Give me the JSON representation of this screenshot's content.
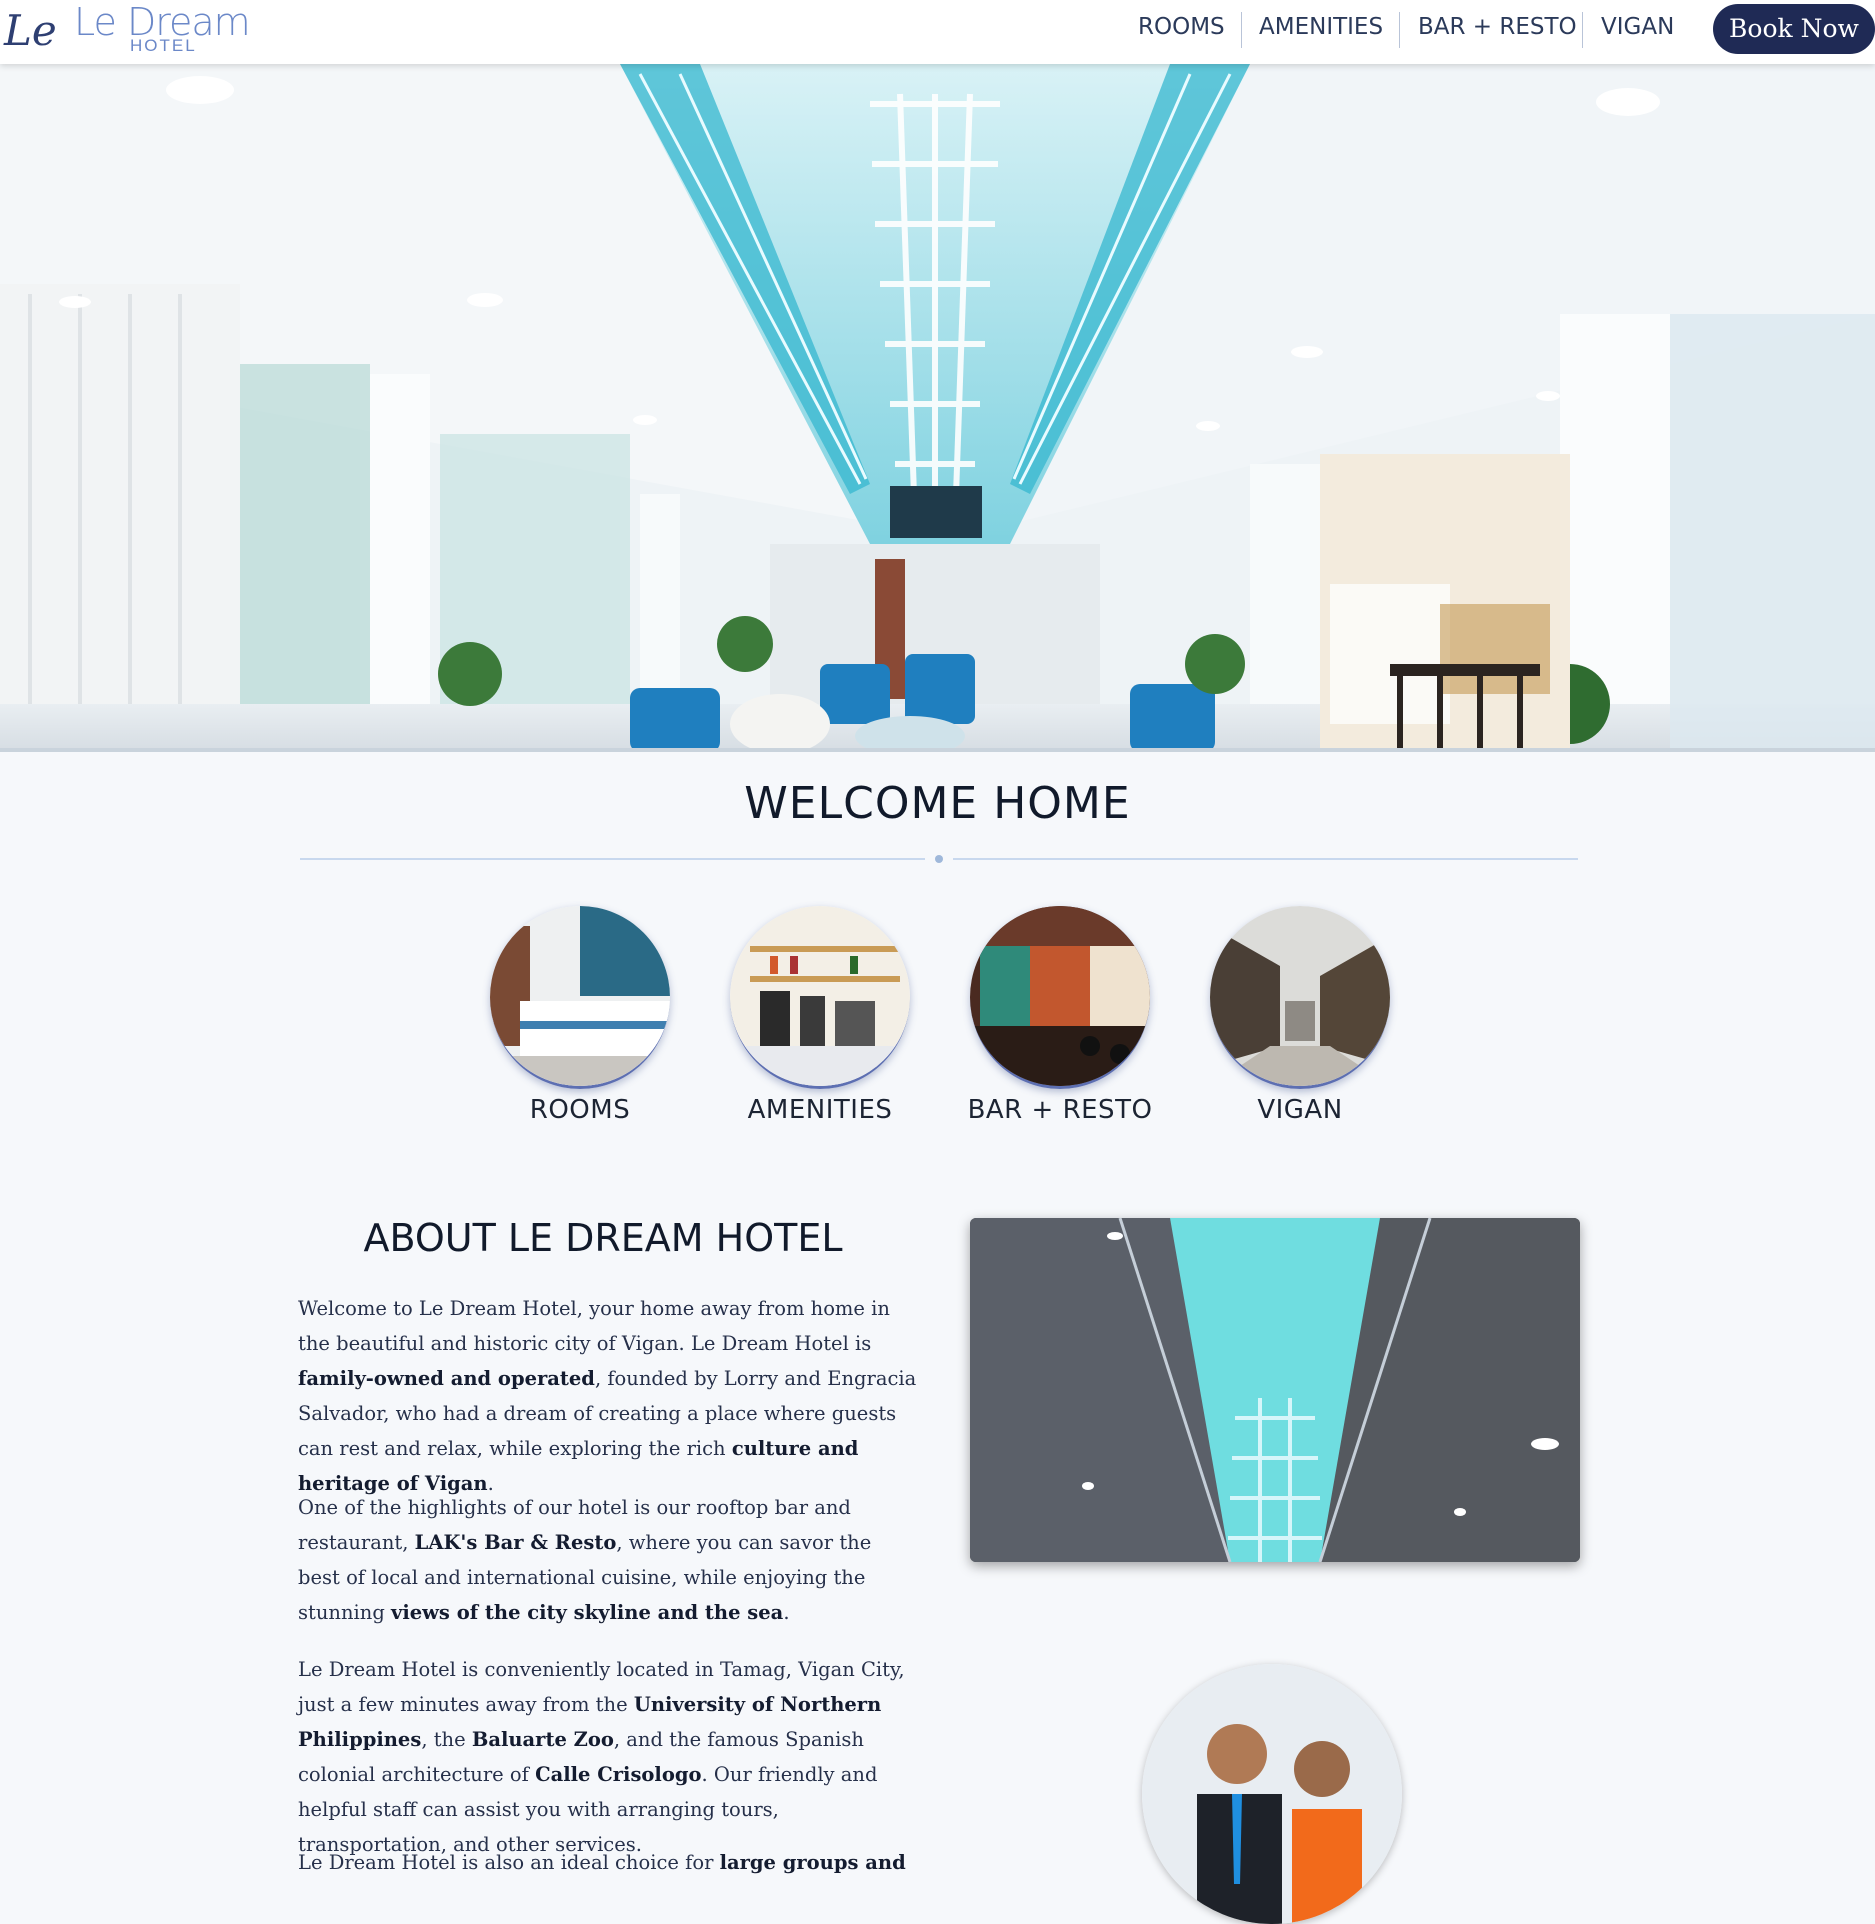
{
  "header": {
    "logo_mark": "Le",
    "logo_name": "Le Dream",
    "logo_sub": "HOTEL",
    "nav": [
      "ROOMS",
      "AMENITIES",
      "BAR + RESTO",
      "VIGAN"
    ],
    "book_now": "Book Now"
  },
  "welcome": {
    "title": "WELCOME HOME",
    "features": [
      "ROOMS",
      "AMENITIES",
      "BAR + RESTO",
      "VIGAN"
    ]
  },
  "about": {
    "title": "ABOUT LE DREAM HOTEL",
    "p1": [
      "Welcome to Le Dream Hotel, your home away from home in the beautiful and historic city of Vigan. Le Dream Hotel is ",
      "family-owned and operated",
      ", founded by Lorry and Engracia Salvador, who had a dream of creating a place where guests can rest and relax, while exploring the rich ",
      "culture and heritage of Vigan",
      "."
    ],
    "p2": [
      "One of the highlights of our hotel is our rooftop bar and restaurant, ",
      "LAK's Bar & Resto",
      ", where you can savor the best of local and international cuisine, while enjoying the stunning ",
      "views of the city skyline and the sea",
      "."
    ],
    "p3": [
      "Le Dream Hotel is conveniently located in Tamag, Vigan City, just a few minutes away from the ",
      "University of Northern Philippines",
      ", the ",
      "Baluarte Zoo",
      ", and the famous Spanish colonial architecture of ",
      "Calle Crisologo",
      ". Our friendly and helpful staff can assist you with arranging tours, transportation, and other services."
    ],
    "p4": [
      "Le Dream Hotel is also an ideal choice for ",
      "large groups and"
    ]
  },
  "colors": {
    "navy": "#1f2a55",
    "accent_blue": "#6b88c8",
    "page_bg": "#f6f8fb"
  }
}
